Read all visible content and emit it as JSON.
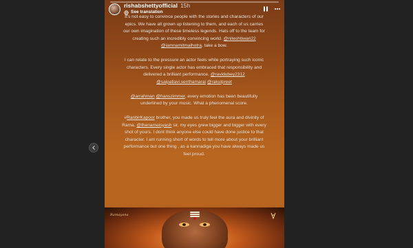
{
  "story": {
    "username": "rishabshettyofficial",
    "time": "15h",
    "translate": "See translation",
    "progress": 0.0,
    "caption": {
      "p1": "It's not easy to convince people with the stories and characters of our epics. We have all grown up listening to them, and each of us carries our own imagination of these timeless legends. Hats off to the team for creating such an incredibly convincing world.",
      "p1_m1": "@niteshtiwari22",
      "p1_m2": "@iamnamitmalhotra",
      "p1_end": ", take a bow.",
      "p2": "I can relate to the pressure an actor feels while portraying such iconic characters. Every single actor has embraced that responsibility and delivered a brilliant performance.",
      "p2_m1": "@ravidubey2312",
      "p2_m2": "@saipallavi.senthamarai",
      "p2_m3": "@rakulpreet",
      "p3_m1": "@arrahman",
      "p3_m2": "@hanszimmer",
      "p3": ", every emotion has been beautifully underlined by your music. What a phenomenal score.",
      "p4_start": "#",
      "p4_m1": "RanbirKapoor",
      "p4_a": " brother, you made us truly feel the aura and divinity of Rama.",
      "p4_m2": "@thenameisyash",
      "p4_b": " sir, my eyes grew bigger and bigger with every shot of yours. I dont think anyone else could have done justice to that character. I am running short of words to tell more about your brilliant performance but one thing , as a kannadiga you have always made us feel proud."
    },
    "art_logo_left": "Ramayana"
  }
}
